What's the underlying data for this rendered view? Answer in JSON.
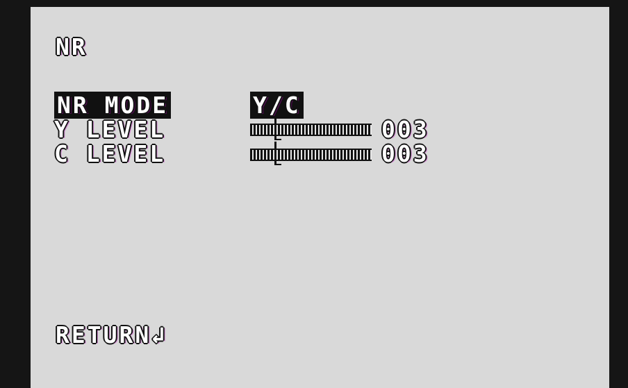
{
  "osd": {
    "title": "NR",
    "rows": [
      {
        "label": "NR MODE",
        "value": "Y/C"
      },
      {
        "label": "Y LEVEL",
        "value": "003",
        "level": 0.2
      },
      {
        "label": "C LEVEL",
        "value": "003",
        "level": 0.2
      }
    ],
    "return_label": "RETURN↲"
  }
}
